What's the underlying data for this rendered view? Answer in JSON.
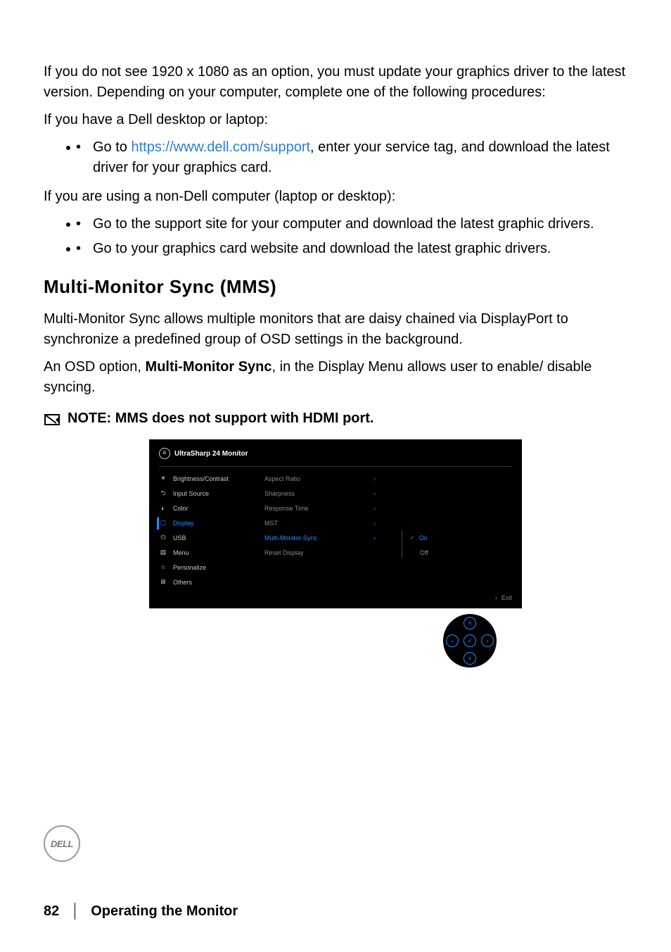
{
  "para1": "If you do not see 1920 x 1080 as an option, you must update your graphics driver to the latest version. Depending on your computer, complete one of the following procedures:",
  "para2": "If you have a Dell desktop or laptop:",
  "bullet1_pre": "Go to ",
  "bullet1_link": "https://www.dell.com/support",
  "bullet1_post": ", enter your service tag, and download the latest driver for your graphics card.",
  "para3": "If you are using a non-Dell computer (laptop or desktop):",
  "bullet2": "Go to the support site for your computer and download the latest graphic drivers.",
  "bullet3": "Go to your graphics card website and download the latest graphic drivers.",
  "heading": "Multi-Monitor Sync (MMS)",
  "mms_p1": "Multi-Monitor Sync allows multiple monitors that are daisy chained via DisplayPort to synchronize a predefined group of OSD settings in the background.",
  "mms_p2_pre": "An OSD option, ",
  "mms_p2_bold": "Multi-Monitor Sync",
  "mms_p2_post": ", in the Display Menu allows user to enable/ disable syncing.",
  "note_text": "NOTE: MMS does not support with HDMI port.",
  "osd": {
    "title": "UltraSharp 24 Monitor",
    "left": [
      "Brightness/Contrast",
      "Input Source",
      "Color",
      "Display",
      "USB",
      "Menu",
      "Personalize",
      "Others"
    ],
    "left_icons": [
      "☀",
      "⮌",
      "◐",
      "▢",
      "⏻",
      "▤",
      "☆",
      "⊞"
    ],
    "mid": [
      "Aspect Ratio",
      "Sharpness",
      "Response Time",
      "MST",
      "Multi-Monitor-Sync",
      "Reset Display"
    ],
    "opts_on": "On",
    "opts_off": "Off",
    "exit": "Exit"
  },
  "footer": {
    "page": "82",
    "section": "Operating the Monitor"
  },
  "dell_badge": "DELL"
}
